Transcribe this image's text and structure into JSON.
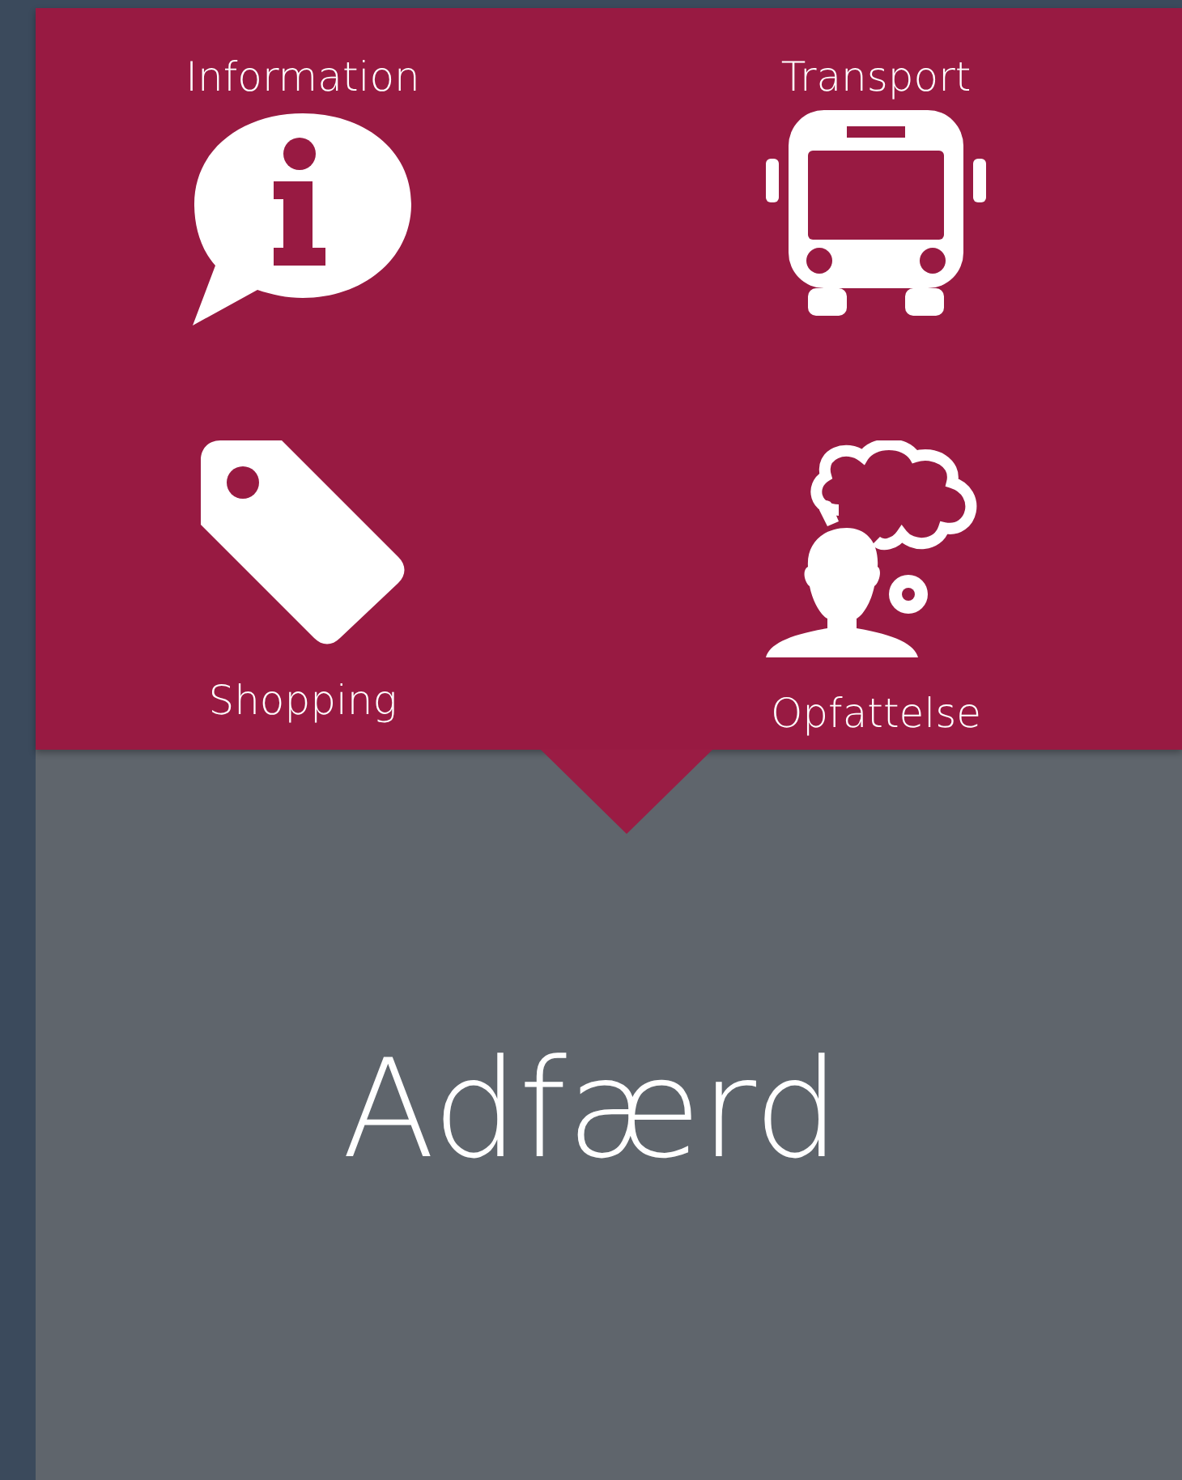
{
  "menu_tiles": [
    {
      "label": "Information"
    },
    {
      "label": "Transport"
    },
    {
      "label": "Shopping"
    },
    {
      "label": "Opfattelse"
    }
  ],
  "section_title": "Adfærd"
}
